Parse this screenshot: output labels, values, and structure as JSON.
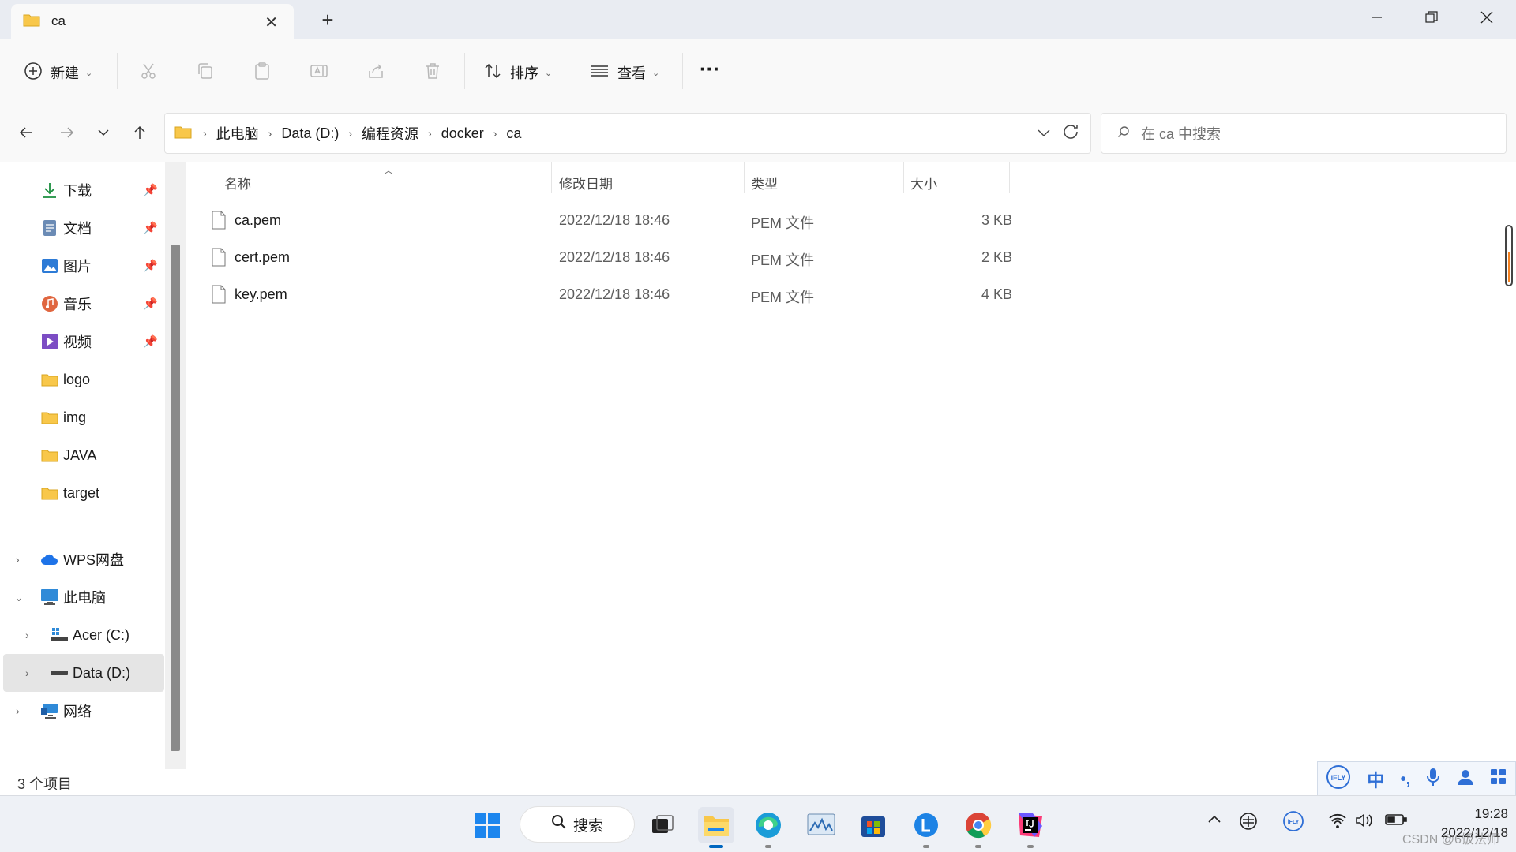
{
  "window": {
    "tab_title": "ca",
    "new_tab": "+",
    "minimize": "—",
    "maximize": "❐",
    "close": "✕"
  },
  "toolbar": {
    "new_label": "新建",
    "sort_label": "排序",
    "view_label": "查看",
    "more": "···"
  },
  "address": {
    "crumbs": [
      "此电脑",
      "Data (D:)",
      "编程资源",
      "docker",
      "ca"
    ],
    "search_placeholder": "在 ca 中搜索"
  },
  "sidebar": {
    "quick": [
      {
        "label": "下载",
        "icon": "download-icon",
        "pinned": true
      },
      {
        "label": "文档",
        "icon": "document-icon",
        "pinned": true
      },
      {
        "label": "图片",
        "icon": "pictures-icon",
        "pinned": true
      },
      {
        "label": "音乐",
        "icon": "music-icon",
        "pinned": true
      },
      {
        "label": "视频",
        "icon": "video-icon",
        "pinned": true
      },
      {
        "label": "logo",
        "icon": "folder-icon",
        "pinned": false
      },
      {
        "label": "img",
        "icon": "folder-icon",
        "pinned": false
      },
      {
        "label": "JAVA",
        "icon": "folder-icon",
        "pinned": false
      },
      {
        "label": "target",
        "icon": "folder-icon",
        "pinned": false
      }
    ],
    "tree": [
      {
        "label": "WPS网盘",
        "icon": "cloud-icon"
      },
      {
        "label": "此电脑",
        "icon": "computer-icon"
      },
      {
        "label": "Acer (C:)",
        "icon": "windows-drive-icon"
      },
      {
        "label": "Data (D:)",
        "icon": "drive-icon"
      },
      {
        "label": "网络",
        "icon": "network-icon"
      }
    ]
  },
  "columns": {
    "name": "名称",
    "date": "修改日期",
    "type": "类型",
    "size": "大小"
  },
  "files": [
    {
      "name": "ca.pem",
      "date": "2022/12/18 18:46",
      "type": "PEM 文件",
      "size": "3 KB"
    },
    {
      "name": "cert.pem",
      "date": "2022/12/18 18:46",
      "type": "PEM 文件",
      "size": "2 KB"
    },
    {
      "name": "key.pem",
      "date": "2022/12/18 18:46",
      "type": "PEM 文件",
      "size": "4 KB"
    }
  ],
  "status": {
    "item_count": "3 个项目"
  },
  "ime": {
    "mode": "中"
  },
  "taskbar": {
    "search_label": "搜索",
    "time": "19:28",
    "date": "2022/12/18"
  },
  "watermark": "CSDN @6饭法师",
  "colors": {
    "folder": "#f8c74a",
    "accent": "#0067c0",
    "selected_bg": "#e5e5e5"
  }
}
